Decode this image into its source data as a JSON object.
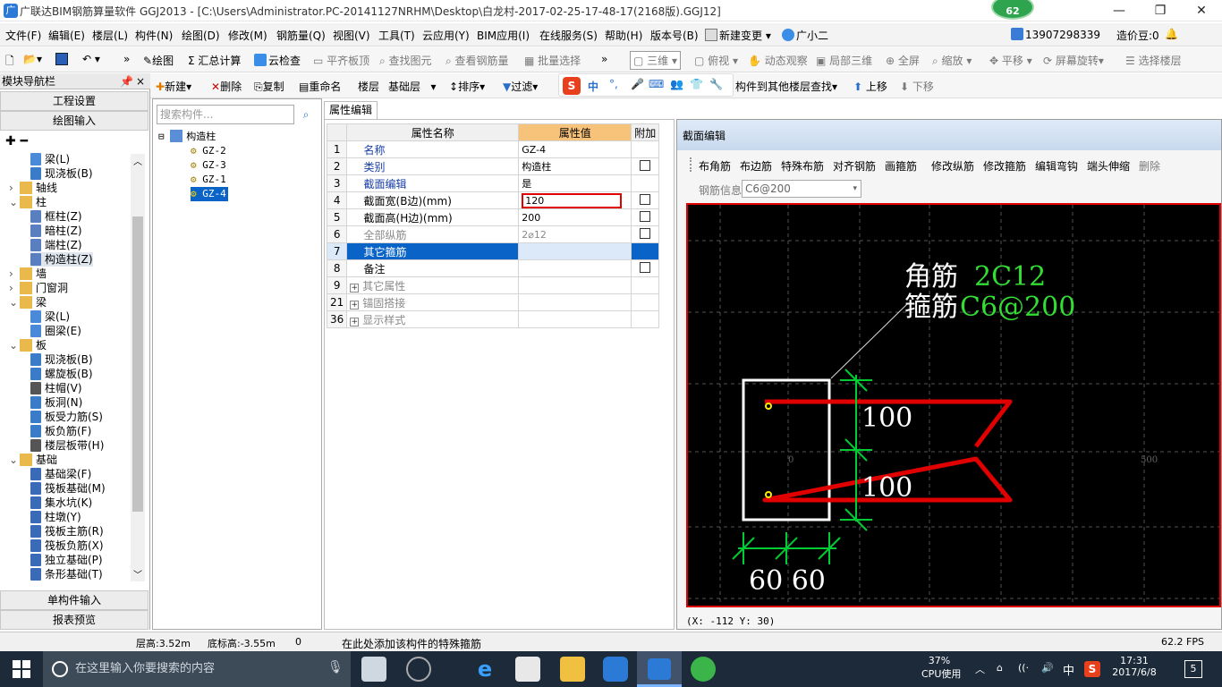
{
  "window": {
    "title": "广联达BIM钢筋算量软件 GGJ2013 - [C:\\Users\\Administrator.PC-20141127NRHM\\Desktop\\白龙村-2017-02-25-17-48-17(2168版).GGJ12]",
    "app_icon": "广",
    "badge": "62"
  },
  "menu": [
    "文件(F)",
    "编辑(E)",
    "楼层(L)",
    "构件(N)",
    "绘图(D)",
    "修改(M)",
    "钢筋量(Q)",
    "视图(V)",
    "工具(T)",
    "云应用(Y)",
    "BIM应用(I)",
    "在线服务(S)",
    "帮助(H)",
    "版本号(B)"
  ],
  "menu_right": {
    "new_change": "新建变更",
    "assistant": "广小二",
    "phone": "13907298339",
    "price": "造价豆:0"
  },
  "toolbar1": {
    "draw": "绘图",
    "sum": "汇总计算",
    "cloud_check": "云检查",
    "level_slab": "平齐板顶",
    "find_elem": "查找图元",
    "view_rebar": "查看钢筋量",
    "batch_select": "批量选择",
    "view_mode": "三维",
    "top_view": "俯视",
    "dynamic": "动态观察",
    "local_3d": "局部三维",
    "fullscreen": "全屏",
    "zoom": "缩放",
    "pan": "平移",
    "rotate": "屏幕旋转",
    "select_layer": "选择楼层"
  },
  "toolbar2": {
    "new": "新建",
    "delete": "删除",
    "copy": "复制",
    "rename": "重命名",
    "floor_label": "楼层",
    "floor": "基础层",
    "sort": "排序",
    "filter": "过滤",
    "ime": "中",
    "copy_to": "构件到其他楼层",
    "find": "查找",
    "up": "上移",
    "down": "下移"
  },
  "nav": {
    "header": "模块导航栏",
    "pin": "📌",
    "close": "×",
    "project_settings": "工程设置",
    "draw_input": "绘图输入",
    "single_input": "单构件输入",
    "report": "报表预览",
    "tree": [
      {
        "label": "梁(L)",
        "level": 2,
        "icon": "beam"
      },
      {
        "label": "现浇板(B)",
        "level": 2,
        "icon": "slab"
      },
      {
        "label": "轴线",
        "level": 0,
        "icon": "folder",
        "exp": "›"
      },
      {
        "label": "柱",
        "level": 0,
        "icon": "folder",
        "exp": "⌄"
      },
      {
        "label": "框柱(Z)",
        "level": 2,
        "icon": "col"
      },
      {
        "label": "暗柱(Z)",
        "level": 2,
        "icon": "col"
      },
      {
        "label": "端柱(Z)",
        "level": 2,
        "icon": "col"
      },
      {
        "label": "构造柱(Z)",
        "level": 2,
        "icon": "col",
        "selected": true
      },
      {
        "label": "墙",
        "level": 0,
        "icon": "folder",
        "exp": "›"
      },
      {
        "label": "门窗洞",
        "level": 0,
        "icon": "folder",
        "exp": "›"
      },
      {
        "label": "梁",
        "level": 0,
        "icon": "folder",
        "exp": "⌄"
      },
      {
        "label": "梁(L)",
        "level": 2,
        "icon": "beam"
      },
      {
        "label": "圈梁(E)",
        "level": 2,
        "icon": "beam"
      },
      {
        "label": "板",
        "level": 0,
        "icon": "folder",
        "exp": "⌄"
      },
      {
        "label": "现浇板(B)",
        "level": 2,
        "icon": "slab"
      },
      {
        "label": "螺旋板(B)",
        "level": 2,
        "icon": "slab"
      },
      {
        "label": "柱帽(V)",
        "level": 2,
        "icon": "cap"
      },
      {
        "label": "板洞(N)",
        "level": 2,
        "icon": "slab"
      },
      {
        "label": "板受力筋(S)",
        "level": 2,
        "icon": "slab"
      },
      {
        "label": "板负筋(F)",
        "level": 2,
        "icon": "slab"
      },
      {
        "label": "楼层板带(H)",
        "level": 2,
        "icon": "band"
      },
      {
        "label": "基础",
        "level": 0,
        "icon": "folder",
        "exp": "⌄"
      },
      {
        "label": "基础梁(F)",
        "level": 2,
        "icon": "found"
      },
      {
        "label": "筏板基础(M)",
        "level": 2,
        "icon": "found"
      },
      {
        "label": "集水坑(K)",
        "level": 2,
        "icon": "found"
      },
      {
        "label": "柱墩(Y)",
        "level": 2,
        "icon": "found"
      },
      {
        "label": "筏板主筋(R)",
        "level": 2,
        "icon": "found"
      },
      {
        "label": "筏板负筋(X)",
        "level": 2,
        "icon": "found"
      },
      {
        "label": "独立基础(P)",
        "level": 2,
        "icon": "found"
      },
      {
        "label": "条形基础(T)",
        "level": 2,
        "icon": "found"
      }
    ]
  },
  "components": {
    "search_placeholder": "搜索构件...",
    "root": "构造柱",
    "items": [
      "GZ-2",
      "GZ-3",
      "GZ-1",
      "GZ-4"
    ],
    "selected": "GZ-4"
  },
  "props": {
    "tab": "属性编辑",
    "headers": {
      "name": "属性名称",
      "value": "属性值",
      "extra": "附加"
    },
    "rows": [
      {
        "n": "1",
        "name": "名称",
        "value": "GZ-4",
        "cb": false,
        "style": "name"
      },
      {
        "n": "2",
        "name": "类别",
        "value": "构造柱",
        "cb": true,
        "style": "name"
      },
      {
        "n": "3",
        "name": "截面编辑",
        "value": "是",
        "cb": false,
        "style": "name"
      },
      {
        "n": "4",
        "name": "截面宽(B边)(mm)",
        "value": "120",
        "cb": true,
        "style": "black",
        "editing": true
      },
      {
        "n": "5",
        "name": "截面高(H边)(mm)",
        "value": "200",
        "cb": true,
        "style": "black"
      },
      {
        "n": "6",
        "name": "全部纵筋",
        "value": "2⌀12",
        "cb": true,
        "style": "gray"
      },
      {
        "n": "7",
        "name": "其它箍筋",
        "value": "",
        "cb": false,
        "style": "sel"
      },
      {
        "n": "8",
        "name": "备注",
        "value": "",
        "cb": true,
        "style": "black"
      },
      {
        "n": "9",
        "name": "其它属性",
        "value": "",
        "cb": false,
        "style": "group"
      },
      {
        "n": "21",
        "name": "锚固搭接",
        "value": "",
        "cb": false,
        "style": "group"
      },
      {
        "n": "36",
        "name": "显示样式",
        "value": "",
        "cb": false,
        "style": "group"
      }
    ]
  },
  "section": {
    "title": "截面编辑",
    "tools": [
      "布角筋",
      "布边筋",
      "特殊布筋",
      "对齐钢筋",
      "画箍筋",
      "修改纵筋",
      "修改箍筋",
      "编辑弯钩",
      "端头伸缩",
      "删除"
    ],
    "rebar_info_label": "钢筋信息",
    "rebar_info_value": "C6@200",
    "canvas": {
      "corner_label": "角筋",
      "corner_value": "2C12",
      "stirrup_label": "箍筋",
      "stirrup_value": "C6@200",
      "dim_h1": "100",
      "dim_h2": "100",
      "dim_w": "60 60",
      "axis_0": "0",
      "axis_500": "500"
    },
    "coord": "(X: -112 Y: 30)"
  },
  "status": {
    "floor_height": "层高:3.52m",
    "base_height": "底标高:-3.55m",
    "zero": "0",
    "hint": "在此处添加该构件的特殊箍筋",
    "fps": "62.2 FPS"
  },
  "taskbar": {
    "search": "在这里输入你要搜索的内容",
    "cpu": "37%",
    "cpu_label": "CPU使用",
    "ime": "中",
    "time": "17:31",
    "date": "2017/6/8",
    "notif": "5"
  },
  "colors": {
    "accent": "#0a64c8",
    "canvas_bg": "#000000",
    "rebar": "#e00000",
    "dim": "#00cc33",
    "label_green": "#33dd33"
  }
}
